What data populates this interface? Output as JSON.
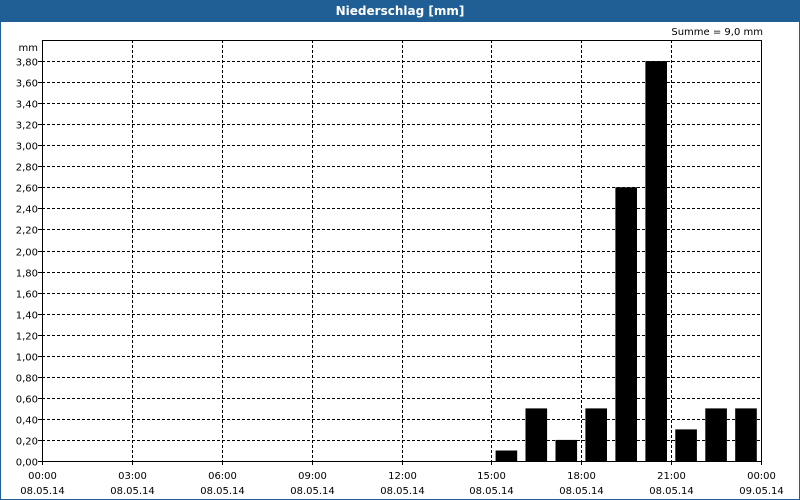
{
  "window": {
    "title": "Niederschlag [mm]"
  },
  "summary": "Summe = 9,0 mm",
  "chart_data": {
    "type": "bar",
    "title": "Niederschlag [mm]",
    "ylabel": "mm",
    "xlabel": "",
    "ylim": [
      0,
      4.0
    ],
    "y_ticks": [
      "0,00",
      "0,20",
      "0,40",
      "0,60",
      "0,80",
      "1,00",
      "1,20",
      "1,40",
      "1,60",
      "1,80",
      "2,00",
      "2,20",
      "2,40",
      "2,60",
      "2,80",
      "3,00",
      "3,20",
      "3,40",
      "3,60",
      "3,80"
    ],
    "x_range_hours": [
      0,
      24
    ],
    "x_ticks": [
      {
        "time": "00:00",
        "date": "08.05.14"
      },
      {
        "time": "03:00",
        "date": "08.05.14"
      },
      {
        "time": "06:00",
        "date": "08.05.14"
      },
      {
        "time": "09:00",
        "date": "08.05.14"
      },
      {
        "time": "12:00",
        "date": "08.05.14"
      },
      {
        "time": "15:00",
        "date": "08.05.14"
      },
      {
        "time": "18:00",
        "date": "08.05.14"
      },
      {
        "time": "21:00",
        "date": "08.05.14"
      },
      {
        "time": "00:00",
        "date": "09.05.14"
      }
    ],
    "bars": [
      {
        "hour": 15.5,
        "value": 0.1
      },
      {
        "hour": 16.5,
        "value": 0.5
      },
      {
        "hour": 17.5,
        "value": 0.2
      },
      {
        "hour": 18.5,
        "value": 0.5
      },
      {
        "hour": 19.5,
        "value": 2.6
      },
      {
        "hour": 20.5,
        "value": 3.8
      },
      {
        "hour": 21.5,
        "value": 0.3
      },
      {
        "hour": 22.5,
        "value": 0.5
      },
      {
        "hour": 23.5,
        "value": 0.5
      }
    ],
    "grid": true,
    "bar_color": "#000000",
    "grid_color": "#000000"
  }
}
